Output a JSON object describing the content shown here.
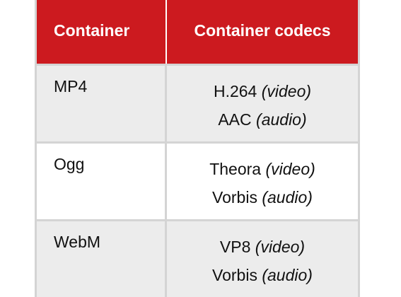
{
  "header": {
    "container": "Container",
    "codecs": "Container codecs"
  },
  "rows": [
    {
      "container": "MP4",
      "codecs": [
        {
          "name": "H.264",
          "type": "(video)"
        },
        {
          "name": "AAC",
          "type": "(audio)"
        }
      ]
    },
    {
      "container": "Ogg",
      "codecs": [
        {
          "name": "Theora",
          "type": "(video)"
        },
        {
          "name": "Vorbis",
          "type": "(audio)"
        }
      ]
    },
    {
      "container": "WebM",
      "codecs": [
        {
          "name": "VP8",
          "type": "(video)"
        },
        {
          "name": "Vorbis",
          "type": "(audio)"
        }
      ]
    }
  ]
}
